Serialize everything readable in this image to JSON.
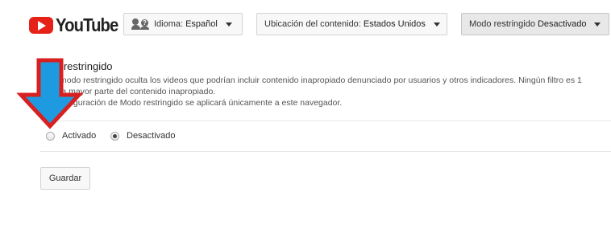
{
  "header": {
    "logo_text": "YouTube",
    "language": {
      "label": "Idioma:",
      "value": "Español"
    },
    "location": {
      "label": "Ubicación del contenido:",
      "value": "Estados Unidos"
    },
    "restricted": {
      "label": "Modo restringido",
      "value": "Desactivado"
    }
  },
  "panel": {
    "title": "o restringido",
    "description_lines": [
      "modo restringido oculta los videos que podrían incluir contenido inapropiado denunciado por usuarios y otros indicadores. Ningún filtro es 1",
      "la mayor parte del contenido inapropiado.",
      "onfiguración de Modo restringido se aplicará únicamente a este navegador."
    ],
    "options": [
      {
        "label": "Activado",
        "checked": false
      },
      {
        "label": "Desactivado",
        "checked": true
      }
    ],
    "save_label": "Guardar"
  },
  "colors": {
    "youtube_red": "#e62117",
    "arrow_fill": "#1e9be0",
    "arrow_outline": "#d92020"
  },
  "icons": [
    "youtube-logo-icon",
    "people-icon",
    "chevron-down-icon",
    "down-arrow-icon"
  ]
}
